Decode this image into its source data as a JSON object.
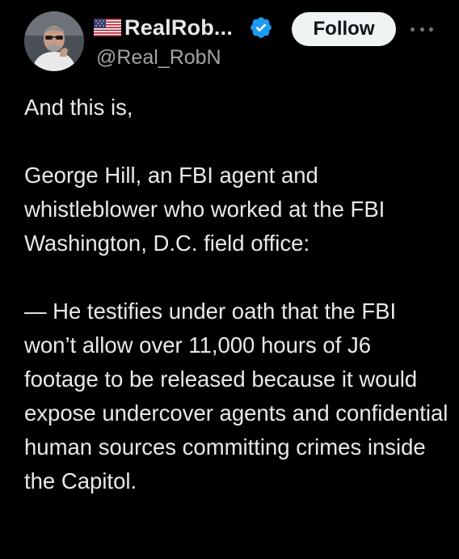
{
  "author": {
    "display_name": "RealRob...",
    "handle": "@Real_RobN",
    "flag_icon": "us-flag-icon",
    "verified_icon": "verified-badge-icon",
    "avatar_icon": "profile-avatar"
  },
  "actions": {
    "follow_label": "Follow",
    "more_icon": "more-options-icon"
  },
  "tweet": {
    "paragraphs": [
      "And this is,",
      "George Hill, an FBI agent and whistleblower who worked at the FBI Washington, D.C. field office:",
      "— He testifies under oath that the FBI won’t allow over 11,000 hours of J6 footage to be released because it would expose undercover agents and confidential human sources committing crimes inside the Capitol."
    ]
  },
  "colors": {
    "background": "#000000",
    "text_primary": "#e7e9ea",
    "text_secondary": "#a0a4a8",
    "verified_blue": "#1d9bf0",
    "follow_bg": "#eff3f4"
  }
}
